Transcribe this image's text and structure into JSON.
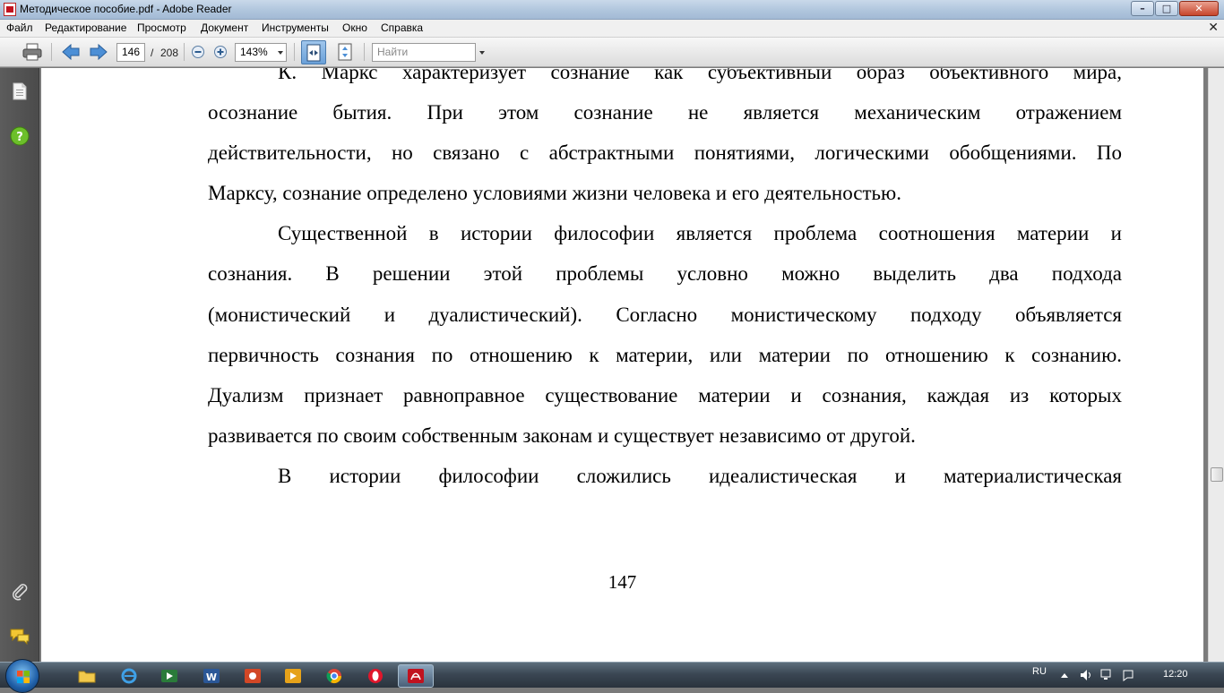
{
  "window": {
    "title": "Методическое пособие.pdf - Adobe Reader"
  },
  "menu": {
    "items": [
      "Файл",
      "Редактирование",
      "Просмотр",
      "Документ",
      "Инструменты",
      "Окно",
      "Справка"
    ]
  },
  "toolbar": {
    "current_page": "146",
    "page_separator": "/",
    "total_pages": "208",
    "zoom": "143%",
    "find_placeholder": "Найти"
  },
  "document": {
    "paragraph1_lines": [
      "К. Маркс характеризует сознание как субъективный образ объективного мира,",
      "осознание бытия. При этом сознание не является механическим отражением",
      "действительности, но связано с абстрактными понятиями, логическими обобщениями. По",
      "Марксу, сознание определено условиями жизни человека и его деятельностью."
    ],
    "paragraph2_lines": [
      "Существенной в истории философии является проблема соотношения материи и",
      "сознания. В решении этой проблемы условно можно выделить два подхода",
      "(монистический и дуалистический). Согласно монистическому подходу объявляется",
      "первичность сознания по отношению к материи, или материи по отношению к сознанию.",
      "Дуализм признает равноправное существование материи и сознания, каждая из которых",
      "развивается по своим собственным законам и существует независимо от другой."
    ],
    "paragraph3_lines": [
      "В истории философии сложились идеалистическая и материалистическая"
    ],
    "page_number": "147"
  },
  "taskbar": {
    "language": "RU",
    "clock": "12:20"
  },
  "colors": {
    "accent": "#6aa0d8",
    "adobe_red": "#c1121f",
    "help_green": "#6cbf2a"
  }
}
